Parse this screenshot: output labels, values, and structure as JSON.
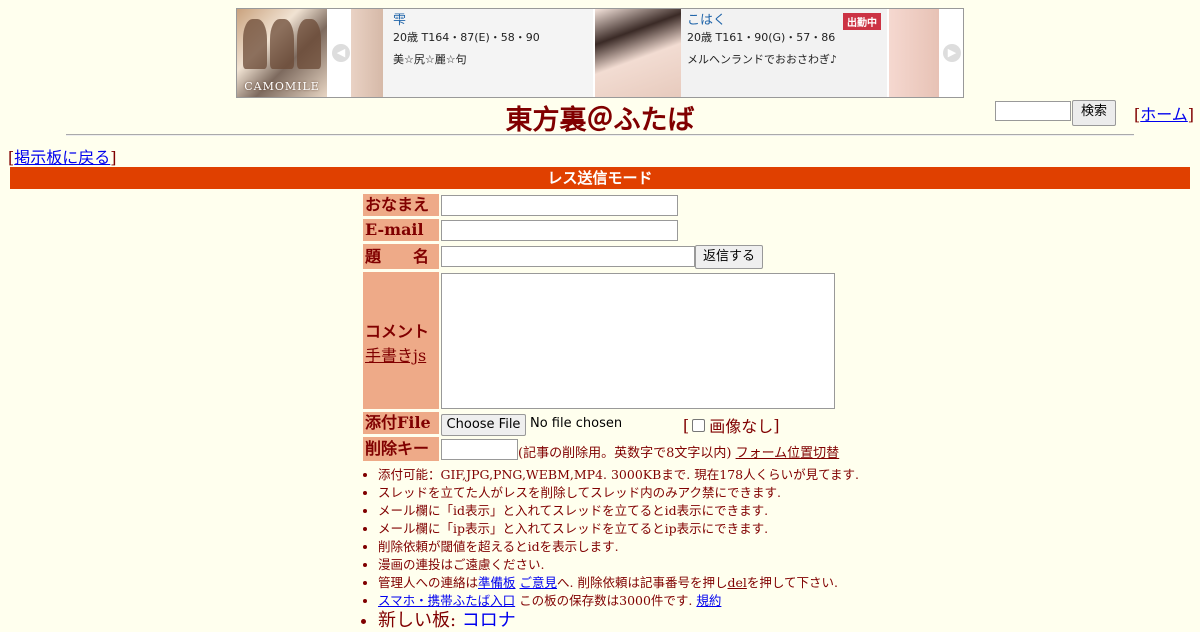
{
  "banner": {
    "logo_text": "CAMOMILE",
    "prev_icon": "chevron-left-icon",
    "next_icon": "chevron-right-icon",
    "cards": [
      {
        "name": "雫",
        "stats": "20歳 T164・87(E)・58・90",
        "catch": "美☆尻☆麗☆句",
        "badge": ""
      },
      {
        "name": "こはく",
        "stats": "20歳 T161・90(G)・57・86",
        "catch": "メルヘンランドでおおさわぎ♪",
        "badge": "出勤中"
      }
    ]
  },
  "header": {
    "title": "東方裏＠ふたば",
    "search_button": "検索",
    "home_link": "ホーム",
    "home_bracket_open": "[",
    "home_bracket_close": "]"
  },
  "nav": {
    "back_link": "掲示板に戻る",
    "bracket_open": "[",
    "bracket_close": "]"
  },
  "mode_bar": {
    "label": "レス送信モード"
  },
  "form": {
    "name_label": "おなまえ",
    "email_label": "E-mail",
    "subject_label": "題　　名",
    "submit_button": "返信する",
    "comment_label": "コメント",
    "handwriting_link": "手書きjs",
    "file_label": "添付File",
    "file_button": "Choose File",
    "file_status": "No file chosen",
    "no_image_open": "[",
    "no_image_label": "画像なし",
    "no_image_close": "]",
    "delkey_label": "削除キー",
    "delkey_hint": "(記事の削除用。英数字で8文字以内)",
    "form_position_link": "フォーム位置切替"
  },
  "notes": {
    "items": [
      "添付可能：GIF,JPG,PNG,WEBM,MP4. 3000KBまで. 現在178人くらいが見てます.",
      "スレッドを立てた人がレスを削除してスレッド内のみアク禁にできます.",
      "メール欄に「id表示」と入れてスレッドを立てるとid表示にできます.",
      "メール欄に「ip表示」と入れてスレッドを立てるとip表示にできます.",
      "削除依頼が閾値を超えるとidを表示します.",
      "漫画の連投はご遠慮ください."
    ],
    "admin_prefix": "管理人への連絡は",
    "admin_link1": "準備板",
    "admin_link2": "ご意見",
    "admin_mid": "へ. 削除依頼は記事番号を押し",
    "admin_del": "del",
    "admin_suffix": "を押して下さい.",
    "mobile_link": "スマホ・携帯ふたば入口",
    "mobile_text": " この板の保存数は3000件です. ",
    "rules_link": "規約",
    "new_board_prefix": "新しい板: ",
    "new_board_link": "コロナ"
  },
  "colors": {
    "background": "#ffffee",
    "text": "#800000",
    "mode_bar": "#e04000",
    "label_bg": "#eeaa88",
    "link": "#0000ee"
  }
}
